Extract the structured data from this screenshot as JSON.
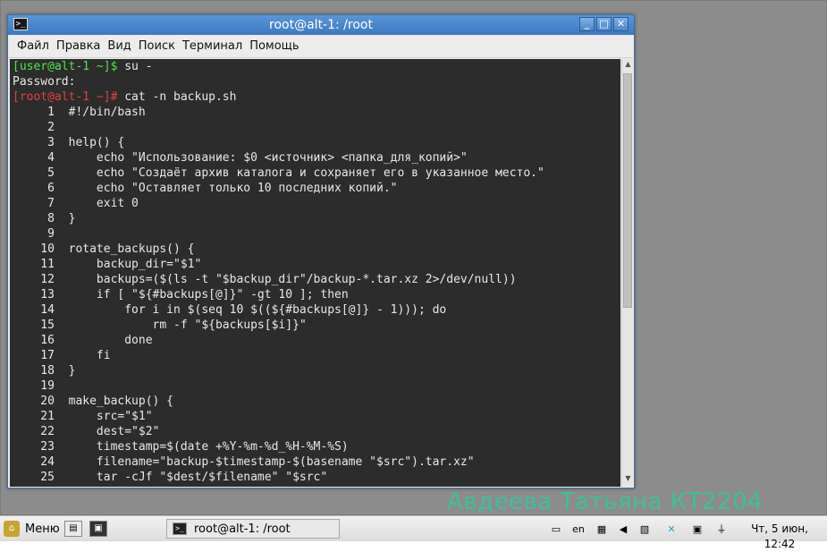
{
  "window": {
    "title": "root@alt-1: /root",
    "menu": [
      "Файл",
      "Правка",
      "Вид",
      "Поиск",
      "Терминал",
      "Помощь"
    ]
  },
  "terminal": {
    "prompt_user": "[user@alt-1 ~]$",
    "cmd_su": " su -",
    "password_prompt": "Password:",
    "prompt_root": "[root@alt-1 ~]#",
    "cmd_cat": " cat -n backup.sh",
    "lines": [
      "     1\t#!/bin/bash",
      "     2\t",
      "     3\thelp() {",
      "     4\t    echo \"Использование: $0 <источник> <папка_для_копий>\"",
      "     5\t    echo \"Создаёт архив каталога и сохраняет его в указанное место.\"",
      "     6\t    echo \"Оставляет только 10 последних копий.\"",
      "     7\t    exit 0",
      "     8\t}",
      "     9\t",
      "    10\trotate_backups() {",
      "    11\t    backup_dir=\"$1\"",
      "    12\t    backups=($(ls -t \"$backup_dir\"/backup-*.tar.xz 2>/dev/null))",
      "    13\t    if [ \"${#backups[@]}\" -gt 10 ]; then",
      "    14\t        for i in $(seq 10 $((${#backups[@]} - 1))); do",
      "    15\t            rm -f \"${backups[$i]}\"",
      "    16\t        done",
      "    17\t    fi",
      "    18\t}",
      "    19\t",
      "    20\tmake_backup() {",
      "    21\t    src=\"$1\"",
      "    22\t    dest=\"$2\"",
      "    23\t    timestamp=$(date +%Y-%m-%d_%H-%M-%S)",
      "    24\t    filename=\"backup-$timestamp-$(basename \"$src\").tar.xz\"",
      "    25\t    tar -cJf \"$dest/$filename\" \"$src\""
    ]
  },
  "desktop": {
    "overlay_text": "Авдеева Татьяна КТ2204"
  },
  "taskbar": {
    "start_label": "Меню",
    "task_label": "root@alt-1: /root",
    "keyboard_layout": "en",
    "clock": "Чт, 5 июн, 12:42"
  }
}
